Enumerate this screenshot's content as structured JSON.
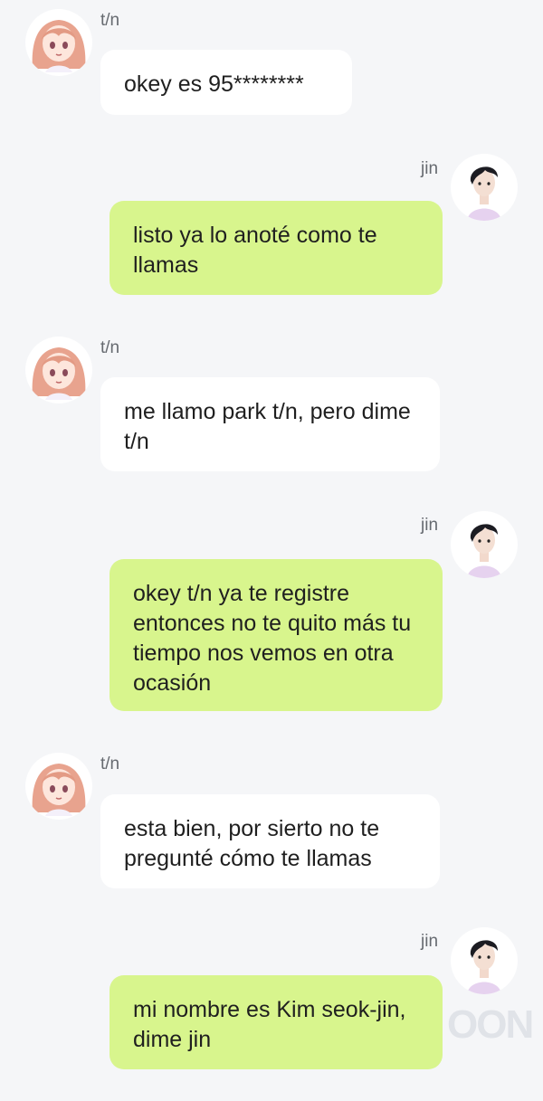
{
  "chat": {
    "messages": [
      {
        "sender": "t/n",
        "side": "left",
        "text": "okey es 95********"
      },
      {
        "sender": "jin",
        "side": "right",
        "text": "listo ya lo anoté como te llamas"
      },
      {
        "sender": "t/n",
        "side": "left",
        "text": "me llamo park t/n, pero dime t/n"
      },
      {
        "sender": "jin",
        "side": "right",
        "text": "okey t/n ya te registre entonces no te quito más tu tiempo nos vemos en otra ocasión"
      },
      {
        "sender": "t/n",
        "side": "left",
        "text": "esta bien, por sierto no te pregunté cómo te llamas"
      },
      {
        "sender": "jin",
        "side": "right",
        "text": "mi nombre es Kim seok-jin, dime jin"
      }
    ]
  },
  "colors": {
    "background": "#f5f6f8",
    "bubble_left": "#ffffff",
    "bubble_right": "#d8f58d"
  },
  "icons": {
    "left_avatar": "anime-girl-avatar",
    "right_avatar": "man-portrait-avatar"
  },
  "watermark": "OON"
}
